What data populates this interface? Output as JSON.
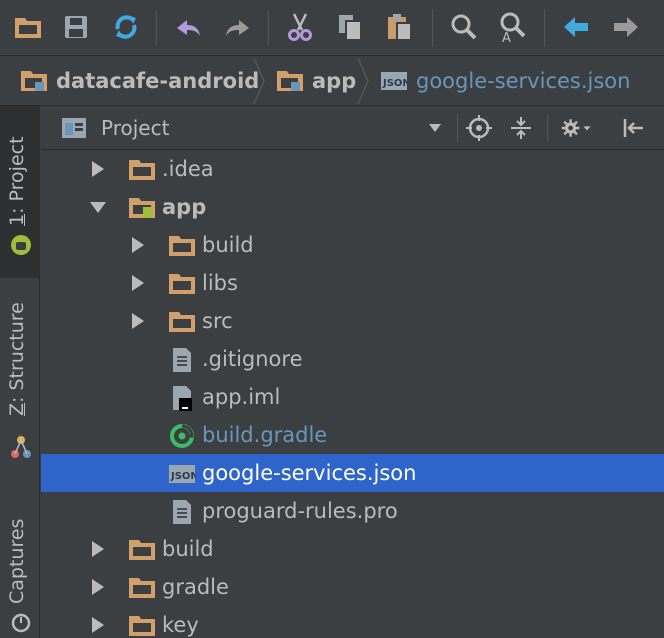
{
  "toolbar": {
    "icons": [
      "open-folder-icon",
      "save-icon",
      "sync-icon",
      "undo-icon",
      "redo-icon",
      "cut-icon",
      "copy-icon",
      "paste-icon",
      "find-icon",
      "replace-icon",
      "back-icon",
      "forward-icon"
    ]
  },
  "breadcrumb": [
    {
      "label": "datacafe-android",
      "icon": "module-folder-icon"
    },
    {
      "label": "app",
      "icon": "module-folder-icon"
    },
    {
      "label": "google-services.json",
      "icon": "json-file-icon"
    }
  ],
  "sidebar": {
    "tabs": [
      {
        "number": "1",
        "label": ": Project",
        "icon": "android-icon",
        "active": true
      },
      {
        "number": "Z",
        "label": ": Structure",
        "icon": "structure-icon",
        "active": false
      },
      {
        "number": "",
        "label": "Captures",
        "icon": "captures-icon",
        "active": false
      }
    ]
  },
  "panel": {
    "title": "Project"
  },
  "tree": [
    {
      "label": ".idea",
      "depth": 0,
      "expanded": false,
      "has_arrow": true,
      "icon": "folder"
    },
    {
      "label": "app",
      "depth": 0,
      "expanded": true,
      "has_arrow": true,
      "icon": "android-module-folder",
      "bold": true
    },
    {
      "label": "build",
      "depth": 1,
      "expanded": false,
      "has_arrow": true,
      "icon": "folder"
    },
    {
      "label": "libs",
      "depth": 1,
      "expanded": false,
      "has_arrow": true,
      "icon": "folder"
    },
    {
      "label": "src",
      "depth": 1,
      "expanded": false,
      "has_arrow": true,
      "icon": "folder"
    },
    {
      "label": ".gitignore",
      "depth": 1,
      "has_arrow": false,
      "icon": "text-file"
    },
    {
      "label": "app.iml",
      "depth": 1,
      "has_arrow": false,
      "icon": "iml-file"
    },
    {
      "label": "build.gradle",
      "depth": 1,
      "has_arrow": false,
      "icon": "gradle-file",
      "gradle": true
    },
    {
      "label": "google-services.json",
      "depth": 1,
      "has_arrow": false,
      "icon": "json-file",
      "selected": true
    },
    {
      "label": "proguard-rules.pro",
      "depth": 1,
      "has_arrow": false,
      "icon": "text-file"
    },
    {
      "label": "build",
      "depth": 0,
      "expanded": false,
      "has_arrow": true,
      "icon": "folder"
    },
    {
      "label": "gradle",
      "depth": 0,
      "expanded": false,
      "has_arrow": true,
      "icon": "folder"
    },
    {
      "label": "key",
      "depth": 0,
      "expanded": false,
      "has_arrow": true,
      "icon": "folder"
    }
  ],
  "colors": {
    "background": "#3c3f41",
    "selection": "#2f65ca",
    "folder": "#d1a06a",
    "link_blue": "#6897bb",
    "gradle_green": "#3dbc68",
    "text": "#bbbbbb"
  }
}
